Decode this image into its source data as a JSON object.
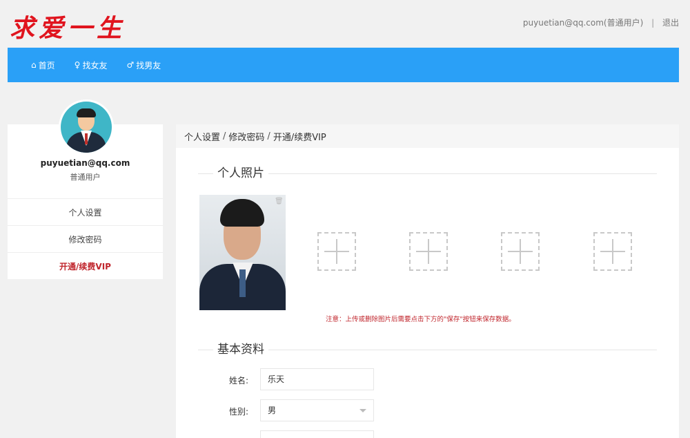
{
  "header": {
    "logo_text": "求爱一生",
    "user_info": "puyuetian@qq.com(普通用户)",
    "separator": "|",
    "logout": "退出"
  },
  "nav": {
    "items": [
      {
        "icon": "home-icon",
        "glyph": "⌂",
        "label": "首页"
      },
      {
        "icon": "female-icon",
        "glyph": "♀",
        "label": "找女友"
      },
      {
        "icon": "male-icon",
        "glyph": "♂",
        "label": "找男友"
      }
    ]
  },
  "sidebar": {
    "email": "puyuetian@qq.com",
    "role": "普通用户",
    "menu": [
      {
        "label": "个人设置"
      },
      {
        "label": "修改密码"
      },
      {
        "label": "开通/续费VIP"
      }
    ]
  },
  "main": {
    "breadcrumb": [
      "个人设置",
      "修改密码",
      "开通/续费VIP"
    ],
    "crumb_sep": "/",
    "photo_section_title": "个人照片",
    "photo_delete_glyph": "🗑",
    "notice": "注意：上传或删除图片后需要点击下方的\"保存\"按钮来保存数据。",
    "basic_section_title": "基本资料",
    "form": {
      "name_label": "姓名:",
      "name_value": "乐天",
      "gender_label": "性别:",
      "gender_value": "男"
    }
  },
  "colors": {
    "navbar": "#2aa0f7",
    "logo": "#e0141e",
    "active_menu": "#c0262d",
    "notice": "#c0262d"
  }
}
